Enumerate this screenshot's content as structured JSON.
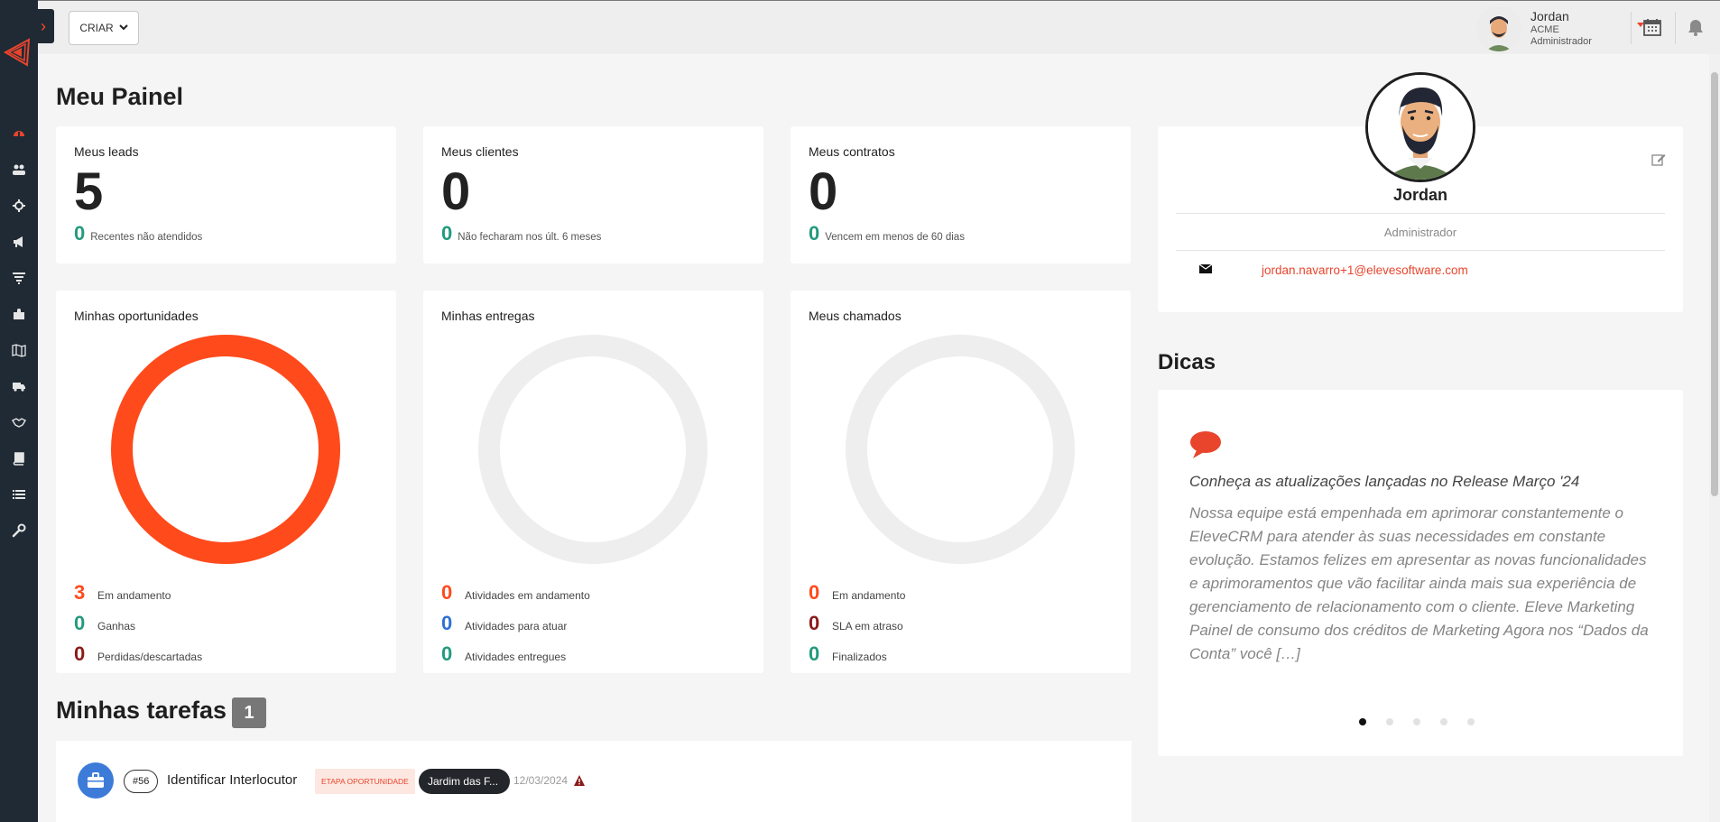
{
  "topbar": {
    "create_label": "CRIAR",
    "user": {
      "name": "Jordan",
      "company": "ACME",
      "role": "Administrador"
    }
  },
  "page": {
    "title": "Meu Painel"
  },
  "stats": [
    {
      "title": "Meus leads",
      "value": "5",
      "sub_value": "0",
      "sub_text": "Recentes não atendidos"
    },
    {
      "title": "Meus clientes",
      "value": "0",
      "sub_value": "0",
      "sub_text": "Não fecharam nos últ. 6 meses"
    },
    {
      "title": "Meus contratos",
      "value": "0",
      "sub_value": "0",
      "sub_text": "Vencem em menos de 60 dias"
    }
  ],
  "donuts": [
    {
      "title": "Minhas oportunidades",
      "ring_color": "#ff4a1c",
      "legend": [
        {
          "value": "3",
          "label": "Em andamento",
          "color": "#ff4a1c"
        },
        {
          "value": "0",
          "label": "Ganhas",
          "color": "#239a7e"
        },
        {
          "value": "0",
          "label": "Perdidas/descartadas",
          "color": "#8b1a1a"
        }
      ]
    },
    {
      "title": "Minhas entregas",
      "ring_color": "#eeeeee",
      "legend": [
        {
          "value": "0",
          "label": "Atividades em andamento",
          "color": "#ff4a1c"
        },
        {
          "value": "0",
          "label": "Atividades para atuar",
          "color": "#2d72d2"
        },
        {
          "value": "0",
          "label": "Atividades entregues",
          "color": "#239a7e"
        }
      ]
    },
    {
      "title": "Meus chamados",
      "ring_color": "#eeeeee",
      "legend": [
        {
          "value": "0",
          "label": "Em andamento",
          "color": "#ff4a1c"
        },
        {
          "value": "0",
          "label": "SLA em atraso",
          "color": "#8b1a1a"
        },
        {
          "value": "0",
          "label": "Finalizados",
          "color": "#239a7e"
        }
      ]
    }
  ],
  "tasks": {
    "title": "Minhas tarefas",
    "count": "1",
    "items": [
      {
        "id": "#56",
        "name": "Identificar Interlocutor",
        "stage": "ETAPA OPORTUNIDADE",
        "company": "Jardim das F...",
        "date": "12/03/2024"
      }
    ]
  },
  "profile": {
    "name": "Jordan",
    "role": "Administrador",
    "email": "jordan.navarro+1@elevesoftware.com"
  },
  "tips": {
    "title": "Dicas",
    "slide_title": "Conheça as atualizações lançadas no Release Março '24",
    "slide_body": "Nossa equipe está empenhada em aprimorar constantemente o EleveCRM para atender às suas necessidades em constante evolução. Estamos felizes em apresentar as novas funcionalidades e aprimoramentos que vão facilitar ainda mais sua experiência de gerenciamento de relacionamento com o cliente. Eleve Marketing Painel de consumo dos créditos de Marketing Agora nos “Dados da Conta” você […]",
    "slide_count": 5,
    "active_slide": 0
  },
  "sidebar": {
    "icons": [
      "dashboard-icon",
      "users-icon",
      "crosshair-icon",
      "megaphone-icon",
      "funnel-icon",
      "puzzle-icon",
      "map-icon",
      "truck-icon",
      "handshake-icon",
      "book-icon",
      "list-icon",
      "wrench-icon"
    ]
  },
  "colors": {
    "accent": "#ff4a1c",
    "green": "#239a7e",
    "sidebar": "#1f2a35"
  }
}
